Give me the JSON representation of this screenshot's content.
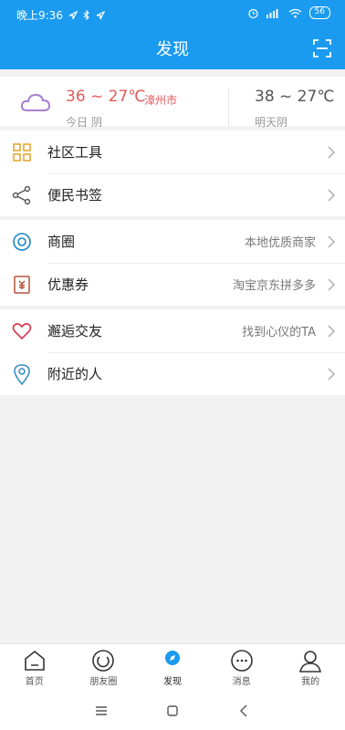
{
  "status": {
    "time": "晚上9:36",
    "battery": "56"
  },
  "header": {
    "title": "发现"
  },
  "weather": {
    "today_temp": "36 ~ 27℃",
    "city": "漳州市",
    "today_desc": "今日 阴",
    "tomorrow_temp": "38 ~ 27℃",
    "tomorrow_desc": "明天阴"
  },
  "groups": [
    {
      "items": [
        {
          "label": "社区工具",
          "sub": ""
        },
        {
          "label": "便民书签",
          "sub": ""
        }
      ]
    },
    {
      "items": [
        {
          "label": "商圈",
          "sub": "本地优质商家"
        },
        {
          "label": "优惠券",
          "sub": "淘宝京东拼多多"
        }
      ]
    },
    {
      "items": [
        {
          "label": "邂逅交友",
          "sub": "找到心仪的TA"
        },
        {
          "label": "附近的人",
          "sub": ""
        }
      ]
    }
  ],
  "tabs": [
    {
      "label": "首页"
    },
    {
      "label": "朋友圈"
    },
    {
      "label": "发现"
    },
    {
      "label": "消息"
    },
    {
      "label": "我的"
    }
  ],
  "colors": {
    "accent": "#1a9bf0",
    "weather_red": "#e05a5a"
  }
}
